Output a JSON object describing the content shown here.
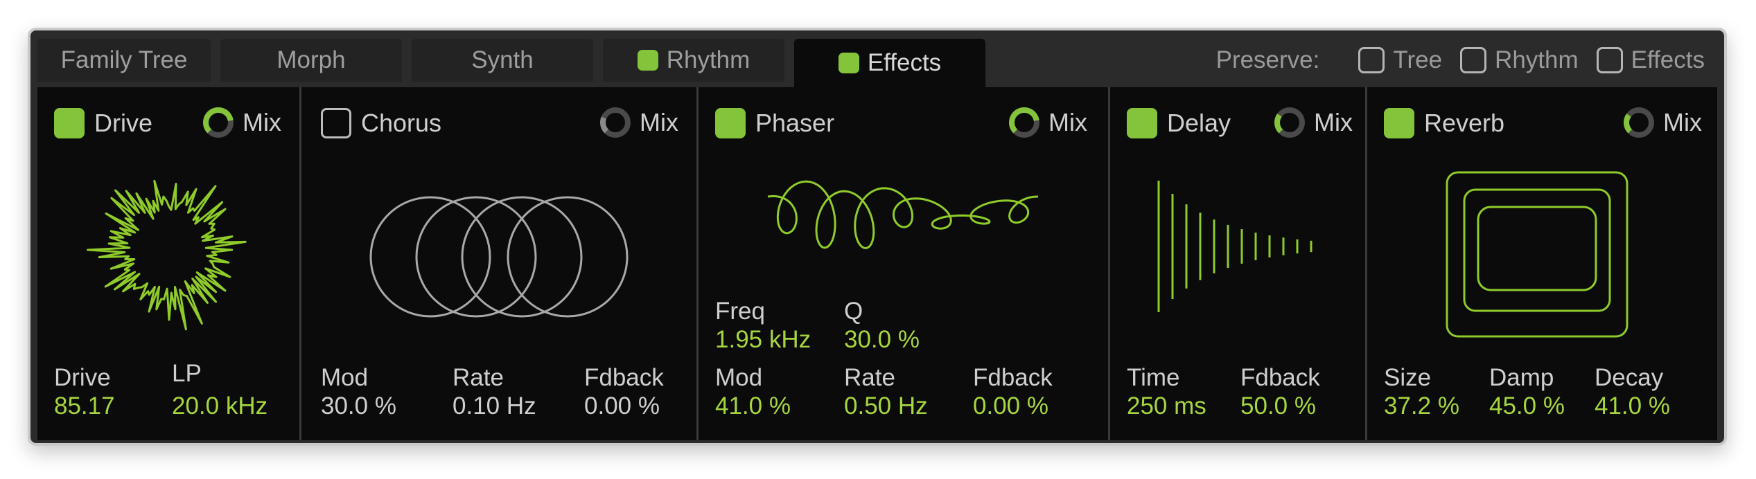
{
  "colors": {
    "accent": "#84c43b",
    "accent_text": "#a6d63f",
    "panel_bg": "#0b0b0b",
    "frame_bg": "#2b2b2b",
    "text": "#cfcfcf"
  },
  "tabs": [
    {
      "label": "Family Tree",
      "checked": null,
      "active": false
    },
    {
      "label": "Morph",
      "checked": null,
      "active": false
    },
    {
      "label": "Synth",
      "checked": null,
      "active": false
    },
    {
      "label": "Rhythm",
      "checked": true,
      "active": false
    },
    {
      "label": "Effects",
      "checked": true,
      "active": true
    }
  ],
  "preserve": {
    "label": "Preserve:",
    "items": [
      {
        "label": "Tree",
        "checked": false
      },
      {
        "label": "Rhythm",
        "checked": false
      },
      {
        "label": "Effects",
        "checked": false
      }
    ]
  },
  "sections": {
    "drive": {
      "name": "Drive",
      "enabled": true,
      "mix_label": "Mix",
      "mix_amount": 0.8,
      "params": [
        {
          "label": "Drive",
          "value": "85.17"
        },
        {
          "label": "LP",
          "value": "20.0 kHz"
        }
      ]
    },
    "chorus": {
      "name": "Chorus",
      "enabled": false,
      "mix_label": "Mix",
      "mix_amount": 0.25,
      "params": [
        {
          "label": "Mod",
          "value": "30.0 %"
        },
        {
          "label": "Rate",
          "value": "0.10 Hz"
        },
        {
          "label": "Fdback",
          "value": "0.00 %"
        }
      ]
    },
    "phaser": {
      "name": "Phaser",
      "enabled": true,
      "mix_label": "Mix",
      "mix_amount": 0.8,
      "params_top": [
        {
          "label": "Freq",
          "value": "1.95 kHz"
        },
        {
          "label": "Q",
          "value": "30.0 %"
        }
      ],
      "params": [
        {
          "label": "Mod",
          "value": "41.0 %"
        },
        {
          "label": "Rate",
          "value": "0.50 Hz"
        },
        {
          "label": "Fdback",
          "value": "0.00 %"
        }
      ]
    },
    "delay": {
      "name": "Delay",
      "enabled": true,
      "mix_label": "Mix",
      "mix_amount": 0.3,
      "params": [
        {
          "label": "Time",
          "value": "250 ms"
        },
        {
          "label": "Fdback",
          "value": "50.0 %"
        }
      ]
    },
    "reverb": {
      "name": "Reverb",
      "enabled": true,
      "mix_label": "Mix",
      "mix_amount": 0.3,
      "params": [
        {
          "label": "Size",
          "value": "37.2 %"
        },
        {
          "label": "Damp",
          "value": "45.0 %"
        },
        {
          "label": "Decay",
          "value": "41.0 %"
        }
      ]
    }
  }
}
